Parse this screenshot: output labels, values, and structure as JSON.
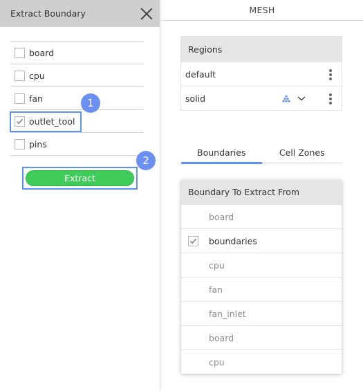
{
  "left_panel": {
    "title": "Extract Boundary",
    "items": [
      {
        "label": "board",
        "checked": false
      },
      {
        "label": "cpu",
        "checked": false
      },
      {
        "label": "fan",
        "checked": false
      },
      {
        "label": "outlet_tool",
        "checked": true
      },
      {
        "label": "pins",
        "checked": false
      }
    ],
    "extract_label": "Extract",
    "badges": [
      "1",
      "2"
    ]
  },
  "right_panel": {
    "title": "MESH",
    "regions": {
      "header": "Regions",
      "rows": [
        {
          "label": "default"
        },
        {
          "label": "solid"
        }
      ]
    },
    "tabs": [
      {
        "label": "Boundaries",
        "active": true
      },
      {
        "label": "Cell Zones",
        "active": false
      }
    ],
    "dropdown": {
      "header": "Boundary To Extract From",
      "items": [
        {
          "label": "board",
          "checked": false
        },
        {
          "label": "boundaries",
          "checked": true
        },
        {
          "label": "cpu",
          "checked": false
        },
        {
          "label": "fan",
          "checked": false
        },
        {
          "label": "fan_inlet",
          "checked": false
        },
        {
          "label": "board",
          "checked": false
        },
        {
          "label": "cpu",
          "checked": false
        }
      ]
    }
  },
  "colors": {
    "accent": "#5b8ff0",
    "extract_button": "#3fcc59",
    "badge": "#6c8ff2",
    "header_bg": "#cfcfcf"
  }
}
